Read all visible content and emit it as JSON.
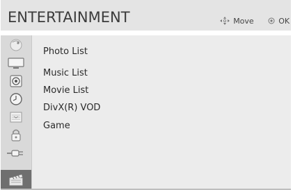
{
  "header": {
    "title": "ENTERTAINMENT",
    "hints": [
      {
        "icon": "move-arrows-icon",
        "label": "Move"
      },
      {
        "icon": "ok-button-icon",
        "label": "OK"
      }
    ]
  },
  "sidebar": {
    "icons": [
      {
        "name": "satellite-dish-icon",
        "selected": false
      },
      {
        "name": "tv-picture-icon",
        "selected": false
      },
      {
        "name": "speaker-audio-icon",
        "selected": false
      },
      {
        "name": "clock-time-icon",
        "selected": false
      },
      {
        "name": "options-grid-icon",
        "selected": false
      },
      {
        "name": "lock-icon",
        "selected": false
      },
      {
        "name": "input-cable-icon",
        "selected": false
      },
      {
        "name": "clapperboard-entertainment-icon",
        "selected": true
      }
    ]
  },
  "menu": {
    "items": [
      "Photo List",
      "Music List",
      "Movie List",
      "DivX(R) VOD",
      "Game"
    ]
  }
}
